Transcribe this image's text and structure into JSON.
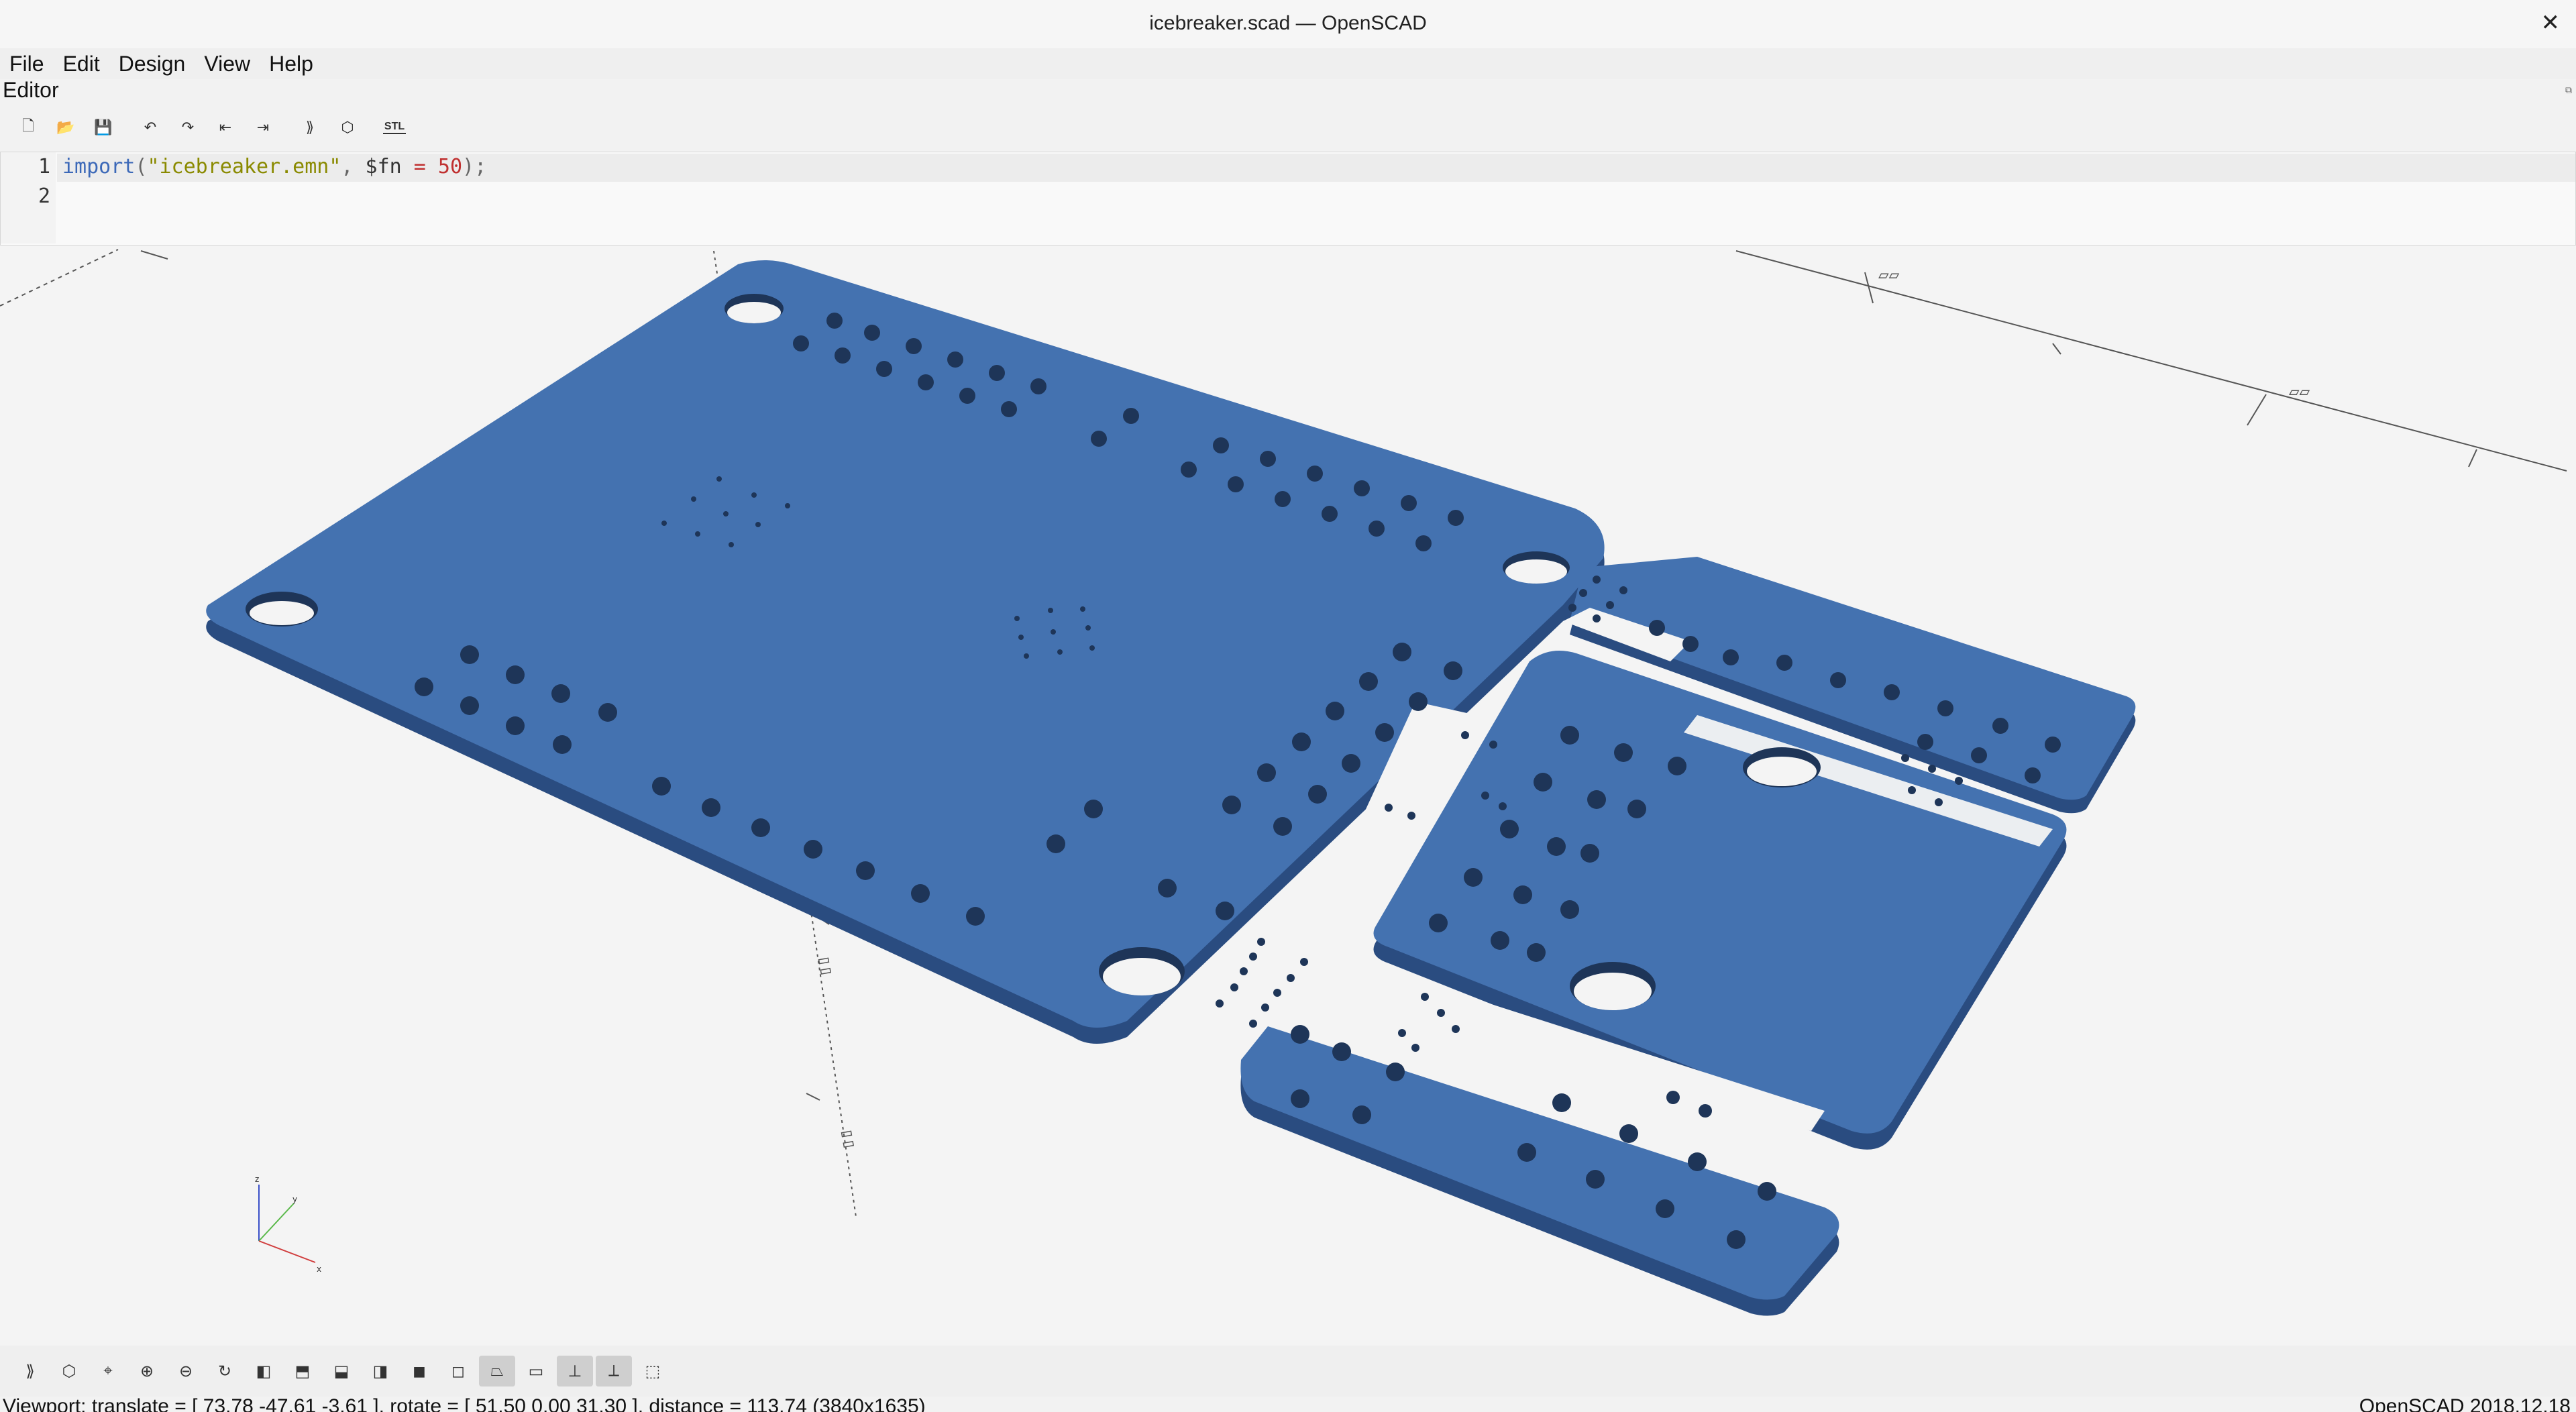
{
  "window": {
    "title": "icebreaker.scad — OpenSCAD"
  },
  "menu": [
    "File",
    "Edit",
    "Design",
    "View",
    "Help"
  ],
  "editor": {
    "label": "Editor",
    "line_numbers": [
      "1",
      "2"
    ],
    "code": {
      "func": "import",
      "open": "(",
      "string": "\"icebreaker.emn\"",
      "sep": ", ",
      "var": "$fn",
      "op": " = ",
      "num": "50",
      "close": ");"
    }
  },
  "toolbar_icons": [
    "new-file-icon",
    "open-file-icon",
    "save-icon",
    "undo-icon",
    "redo-icon",
    "unindent-icon",
    "indent-icon",
    "preview-icon",
    "render-icon",
    "export-stl-icon"
  ],
  "stl_label": "STL",
  "viewport": {
    "board_color": "#4472b0",
    "board_edge_color": "#2a4c80",
    "axis_labels": {
      "z": "z",
      "y": "y",
      "x": "x"
    }
  },
  "status": {
    "viewport": "Viewport: translate = [ 73.78 -47.61 -3.61 ], rotate = [ 51.50 0.00 31.30 ], distance = 113.74 (3840x1635)",
    "version": "OpenSCAD 2018.12.18"
  }
}
